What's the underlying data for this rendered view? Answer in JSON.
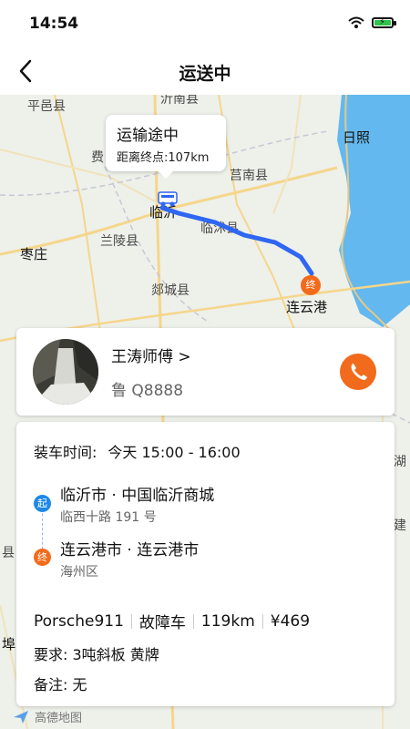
{
  "status_bar": {
    "time": "14:54"
  },
  "nav": {
    "title": "运送中"
  },
  "map": {
    "labels": {
      "pingyi": "平邑县",
      "yishui": "沂南县",
      "rizhao": "日照",
      "fei": "费",
      "junan": "莒南县",
      "linyi": "临沂",
      "linshu": "临沭县",
      "zaozhuang": "枣庄",
      "lanling": "兰陵县",
      "tancheng": "郯城县",
      "lianyungang": "连云港",
      "left_edge": "县",
      "left_edge2": "埠",
      "right_edge": "建",
      "right_edge2": "湖"
    },
    "route_tip": {
      "title": "运输途中",
      "distance": "距离终点:107km"
    },
    "end_marker": "终",
    "logo": "高德地图"
  },
  "driver": {
    "name": "王涛师傅 >",
    "plate": "鲁 Q8888"
  },
  "order": {
    "load_time_label": "装车时间:",
    "load_time_value": "今天 15:00 - 16:00",
    "start_badge": "起",
    "start_title": "临沂市 · 中国临沂商城",
    "start_sub": "临西十路 191 号",
    "end_badge": "终",
    "end_title": "连云港市 · 连云港市",
    "end_sub": "海州区",
    "vehicle": "Porsche911",
    "status": "故障车",
    "distance": "119km",
    "price": "¥469",
    "requirement": "要求: 3吨斜板 黄牌",
    "remark": "备注: 无"
  },
  "colors": {
    "accent": "#f26a1b",
    "route": "#2f66f2",
    "start": "#1e88e5",
    "sea": "#63b8ef"
  }
}
